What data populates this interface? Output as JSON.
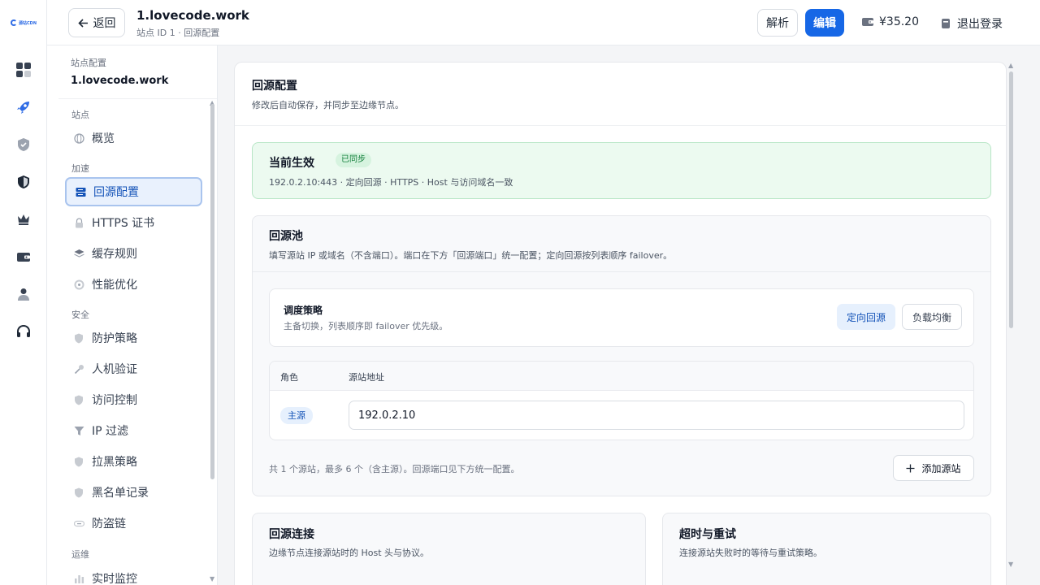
{
  "brand": {
    "logo_text": "源站CDN"
  },
  "header": {
    "back_label": "返回",
    "site_name": "1.lovecode.work",
    "site_subtitle": "站点 ID 1 · 回源配置",
    "parse_label": "解析",
    "edit_label": "编辑",
    "balance": "¥35.20",
    "logout_label": "退出登录"
  },
  "sidebar": {
    "caption": "站点配置",
    "site_name": "1.lovecode.work",
    "groups": {
      "site": "站点",
      "accel": "加速",
      "security": "安全",
      "ops": "运维"
    },
    "items": [
      {
        "label": "概览",
        "icon": "globe-icon"
      },
      {
        "label": "回源配置",
        "icon": "server-icon",
        "active": true
      },
      {
        "label": "HTTPS 证书",
        "icon": "lock-icon"
      },
      {
        "label": "缓存规则",
        "icon": "layers-icon"
      },
      {
        "label": "性能优化",
        "icon": "gauge-icon"
      },
      {
        "label": "防护策略",
        "icon": "shield-icon"
      },
      {
        "label": "人机验证",
        "icon": "key-icon"
      },
      {
        "label": "访问控制",
        "icon": "shield-icon"
      },
      {
        "label": "IP 过滤",
        "icon": "filter-icon"
      },
      {
        "label": "拉黑策略",
        "icon": "shield-icon"
      },
      {
        "label": "黑名单记录",
        "icon": "shield-icon"
      },
      {
        "label": "防盗链",
        "icon": "link-icon"
      },
      {
        "label": "实时监控",
        "icon": "chart-icon"
      }
    ]
  },
  "main": {
    "title": "回源配置",
    "subtitle": "修改后自动保存，并同步至边缘节点。",
    "current": {
      "title": "当前生效",
      "badge": "已同步",
      "detail": "192.0.2.10:443 · 定向回源 · HTTPS · Host 与访问域名一致"
    },
    "pool": {
      "title": "回源池",
      "desc": "填写源站 IP 或域名（不含端口）。端口在下方「回源端口」统一配置；定向回源按列表顺序 failover。",
      "schedule_title": "调度策略",
      "schedule_desc": "主备切换，列表顺序即 failover 优先级。",
      "mode_directed": "定向回源",
      "mode_balance": "负载均衡",
      "col_role": "角色",
      "col_address": "源站地址",
      "row_role": "主源",
      "row_address": "192.0.2.10",
      "footer": "共 1 个源站，最多 6 个（含主源）。回源端口见下方统一配置。",
      "add_label": "添加源站"
    },
    "connection": {
      "title": "回源连接",
      "desc": "边缘节点连接源站时的 Host 头与协议。"
    },
    "retry": {
      "title": "超时与重试",
      "desc": "连接源站失败时的等待与重试策略。"
    }
  },
  "colors": {
    "primary": "#1667e6",
    "success_bg": "#ecfaf0",
    "success_text": "#15803d"
  }
}
